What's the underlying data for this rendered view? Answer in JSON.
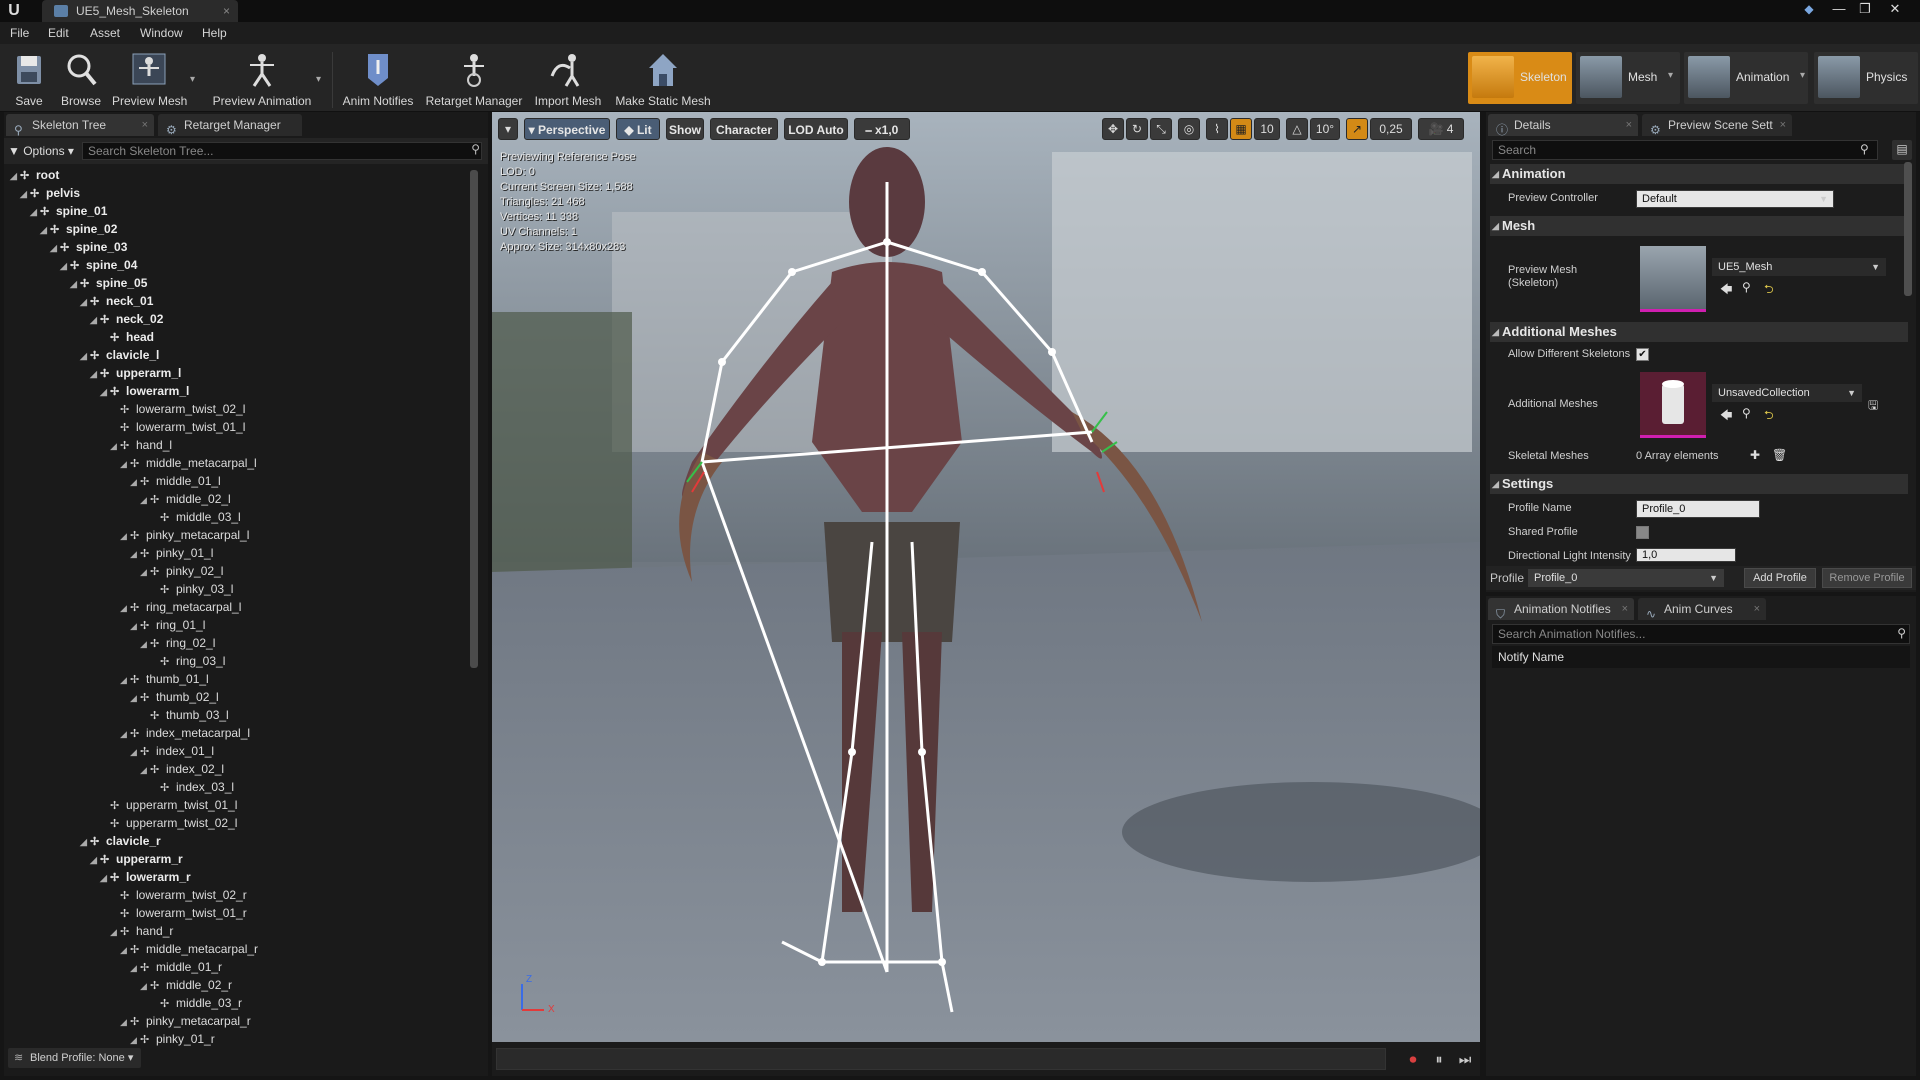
{
  "window": {
    "tab_title": "UE5_Mesh_Skeleton",
    "tab_close": "×",
    "minimize": "—",
    "maximize": "❐",
    "close": "✕"
  },
  "menu": [
    "File",
    "Edit",
    "Asset",
    "Window",
    "Help"
  ],
  "toolbar": {
    "buttons": [
      {
        "label": "Save",
        "icon": "save-icon"
      },
      {
        "label": "Browse",
        "icon": "browse-icon"
      },
      {
        "label": "Preview Mesh",
        "icon": "preview-mesh-icon"
      },
      {
        "label": "Preview Animation",
        "icon": "preview-animation-icon"
      },
      {
        "label": "Anim Notifies",
        "icon": "anim-notifies-icon"
      },
      {
        "label": "Retarget Manager",
        "icon": "retarget-manager-icon"
      },
      {
        "label": "Import Mesh",
        "icon": "import-mesh-icon"
      },
      {
        "label": "Make Static Mesh",
        "icon": "make-static-mesh-icon"
      }
    ],
    "modes": [
      {
        "label": "Skeleton",
        "active": true
      },
      {
        "label": "Mesh",
        "active": false
      },
      {
        "label": "Animation",
        "active": false
      },
      {
        "label": "Physics",
        "active": false
      }
    ]
  },
  "left_panel": {
    "tabs": [
      "Skeleton Tree",
      "Retarget Manager"
    ],
    "options_label": "Options",
    "search_placeholder": "Search Skeleton Tree...",
    "blend_profile": "Blend Profile: None",
    "tree": [
      {
        "name": "root",
        "depth": 0,
        "bold": true,
        "expandable": true
      },
      {
        "name": "pelvis",
        "depth": 1,
        "bold": true,
        "expandable": true
      },
      {
        "name": "spine_01",
        "depth": 2,
        "bold": true,
        "expandable": true
      },
      {
        "name": "spine_02",
        "depth": 3,
        "bold": true,
        "expandable": true
      },
      {
        "name": "spine_03",
        "depth": 4,
        "bold": true,
        "expandable": true
      },
      {
        "name": "spine_04",
        "depth": 5,
        "bold": true,
        "expandable": true
      },
      {
        "name": "spine_05",
        "depth": 6,
        "bold": true,
        "expandable": true
      },
      {
        "name": "neck_01",
        "depth": 7,
        "bold": true,
        "expandable": true
      },
      {
        "name": "neck_02",
        "depth": 8,
        "bold": true,
        "expandable": true
      },
      {
        "name": "head",
        "depth": 9,
        "bold": true,
        "expandable": false
      },
      {
        "name": "clavicle_l",
        "depth": 7,
        "bold": true,
        "expandable": true
      },
      {
        "name": "upperarm_l",
        "depth": 8,
        "bold": true,
        "expandable": true
      },
      {
        "name": "lowerarm_l",
        "depth": 9,
        "bold": true,
        "expandable": true
      },
      {
        "name": "lowerarm_twist_02_l",
        "depth": 10,
        "bold": false,
        "expandable": false
      },
      {
        "name": "lowerarm_twist_01_l",
        "depth": 10,
        "bold": false,
        "expandable": false
      },
      {
        "name": "hand_l",
        "depth": 10,
        "bold": false,
        "expandable": true
      },
      {
        "name": "middle_metacarpal_l",
        "depth": 11,
        "bold": false,
        "expandable": true
      },
      {
        "name": "middle_01_l",
        "depth": 12,
        "bold": false,
        "expandable": true
      },
      {
        "name": "middle_02_l",
        "depth": 13,
        "bold": false,
        "expandable": true
      },
      {
        "name": "middle_03_l",
        "depth": 14,
        "bold": false,
        "expandable": false
      },
      {
        "name": "pinky_metacarpal_l",
        "depth": 11,
        "bold": false,
        "expandable": true
      },
      {
        "name": "pinky_01_l",
        "depth": 12,
        "bold": false,
        "expandable": true
      },
      {
        "name": "pinky_02_l",
        "depth": 13,
        "bold": false,
        "expandable": true
      },
      {
        "name": "pinky_03_l",
        "depth": 14,
        "bold": false,
        "expandable": false
      },
      {
        "name": "ring_metacarpal_l",
        "depth": 11,
        "bold": false,
        "expandable": true
      },
      {
        "name": "ring_01_l",
        "depth": 12,
        "bold": false,
        "expandable": true
      },
      {
        "name": "ring_02_l",
        "depth": 13,
        "bold": false,
        "expandable": true
      },
      {
        "name": "ring_03_l",
        "depth": 14,
        "bold": false,
        "expandable": false
      },
      {
        "name": "thumb_01_l",
        "depth": 11,
        "bold": false,
        "expandable": true
      },
      {
        "name": "thumb_02_l",
        "depth": 12,
        "bold": false,
        "expandable": true
      },
      {
        "name": "thumb_03_l",
        "depth": 13,
        "bold": false,
        "expandable": false
      },
      {
        "name": "index_metacarpal_l",
        "depth": 11,
        "bold": false,
        "expandable": true
      },
      {
        "name": "index_01_l",
        "depth": 12,
        "bold": false,
        "expandable": true
      },
      {
        "name": "index_02_l",
        "depth": 13,
        "bold": false,
        "expandable": true
      },
      {
        "name": "index_03_l",
        "depth": 14,
        "bold": false,
        "expandable": false
      },
      {
        "name": "upperarm_twist_01_l",
        "depth": 9,
        "bold": false,
        "expandable": false
      },
      {
        "name": "upperarm_twist_02_l",
        "depth": 9,
        "bold": false,
        "expandable": false
      },
      {
        "name": "clavicle_r",
        "depth": 7,
        "bold": true,
        "expandable": true
      },
      {
        "name": "upperarm_r",
        "depth": 8,
        "bold": true,
        "expandable": true
      },
      {
        "name": "lowerarm_r",
        "depth": 9,
        "bold": true,
        "expandable": true
      },
      {
        "name": "lowerarm_twist_02_r",
        "depth": 10,
        "bold": false,
        "expandable": false
      },
      {
        "name": "lowerarm_twist_01_r",
        "depth": 10,
        "bold": false,
        "expandable": false
      },
      {
        "name": "hand_r",
        "depth": 10,
        "bold": false,
        "expandable": true
      },
      {
        "name": "middle_metacarpal_r",
        "depth": 11,
        "bold": false,
        "expandable": true
      },
      {
        "name": "middle_01_r",
        "depth": 12,
        "bold": false,
        "expandable": true
      },
      {
        "name": "middle_02_r",
        "depth": 13,
        "bold": false,
        "expandable": true
      },
      {
        "name": "middle_03_r",
        "depth": 14,
        "bold": false,
        "expandable": false
      },
      {
        "name": "pinky_metacarpal_r",
        "depth": 11,
        "bold": false,
        "expandable": true
      },
      {
        "name": "pinky_01_r",
        "depth": 12,
        "bold": false,
        "expandable": true
      }
    ]
  },
  "viewport": {
    "toolbar": {
      "menu_arrow": "▾",
      "perspective": "Perspective",
      "lit": "Lit",
      "show": "Show",
      "character": "Character",
      "lod": "LOD Auto",
      "speed": "x1,0",
      "grid_snap": "10",
      "rotation_snap": "10°",
      "scale_snap": "0,25",
      "camera_speed": "4"
    },
    "stats": [
      "Previewing Reference Pose",
      "LOD: 0",
      "Current Screen Size: 1,588",
      "Triangles: 21 468",
      "Vertices: 11 338",
      "UV Channels: 1",
      "Approx Size: 314x80x283"
    ],
    "axis": {
      "z": "Z",
      "x": "X"
    }
  },
  "details": {
    "tabs": [
      "Details",
      "Preview Scene Sett"
    ],
    "search_placeholder": "Search",
    "categories": {
      "animation": "Animation",
      "mesh": "Mesh",
      "additional": "Additional Meshes",
      "settings": "Settings"
    },
    "preview_controller_label": "Preview Controller",
    "preview_controller_value": "Default",
    "preview_mesh_label": "Preview Mesh\n(Skeleton)",
    "preview_mesh_value": "UE5_Mesh",
    "allow_different_skeletons_label": "Allow Different Skeletons",
    "allow_different_skeletons": true,
    "additional_meshes_label": "Additional Meshes",
    "additional_meshes_value": "UnsavedCollection",
    "skeletal_meshes_label": "Skeletal Meshes",
    "skeletal_meshes_value": "0 Array elements",
    "profile_name_label": "Profile Name",
    "profile_name_value": "Profile_0",
    "shared_profile_label": "Shared Profile",
    "shared_profile": false,
    "directional_light_label": "Directional Light Intensity",
    "directional_light_value": "1,0",
    "profile_bar_label": "Profile",
    "profile_bar_value": "Profile_0",
    "add_profile": "Add Profile",
    "remove_profile": "Remove Profile"
  },
  "notifies": {
    "tabs": [
      "Animation Notifies",
      "Anim Curves"
    ],
    "search_placeholder": "Search Animation Notifies...",
    "column": "Notify Name"
  },
  "colors": {
    "accent_orange": "#d98b16",
    "panel_bg": "#1c1c1c",
    "selection_pink": "#d01fb0"
  }
}
